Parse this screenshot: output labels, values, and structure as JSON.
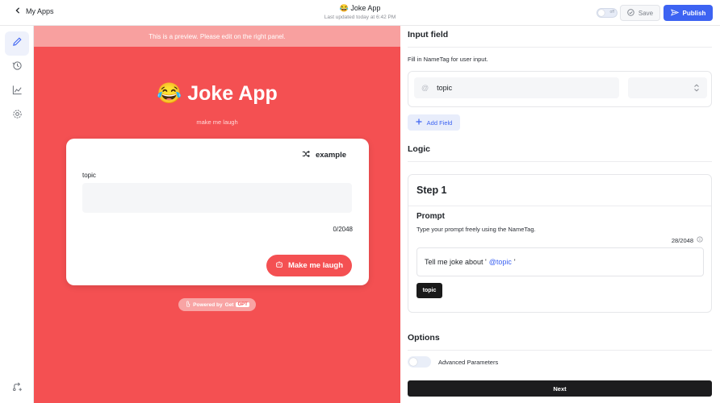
{
  "header": {
    "back_label": "My Apps",
    "app_emoji": "😂",
    "app_name": "Joke App",
    "last_updated": "Last updated today at 6:42 PM",
    "toggle_label": "off",
    "save_label": "Save",
    "publish_label": "Publish",
    "accent_color": "#3d63f2"
  },
  "sidebar": {
    "items": [
      {
        "name": "edit",
        "icon": "pencil-icon",
        "active": true
      },
      {
        "name": "history",
        "icon": "history-icon",
        "active": false
      },
      {
        "name": "analytics",
        "icon": "chart-icon",
        "active": false
      },
      {
        "name": "settings",
        "icon": "gear-icon",
        "active": false
      },
      {
        "name": "integrations",
        "icon": "branch-icon",
        "active": false
      }
    ]
  },
  "preview": {
    "banner": "This is a preview. Please edit on the right panel.",
    "title": "😂 Joke App",
    "subtitle": "make me laugh",
    "example_label": "example",
    "field_label": "topic",
    "field_value": "",
    "counter": "0/2048",
    "submit_label": "Make me laugh",
    "powered_prefix": "Powered by",
    "powered_brand_a": "Get",
    "powered_brand_b": "GPT",
    "theme_color": "#f45052"
  },
  "panel": {
    "input_section_title": "Input field",
    "input_hint": "Fill in NameTag for user input.",
    "nametag_value": "topic",
    "add_field_label": "Add Field",
    "logic_title": "Logic",
    "step_title": "Step 1",
    "prompt_title": "Prompt",
    "prompt_desc": "Type your prompt freely using the NameTag.",
    "prompt_count": "28/2048",
    "prompt_text_before": "Tell me joke about '",
    "prompt_tag": "@topic",
    "prompt_text_after": "'",
    "chip_label": "topic",
    "options_title": "Options",
    "advanced_label": "Advanced Parameters",
    "next_label": "Next"
  }
}
